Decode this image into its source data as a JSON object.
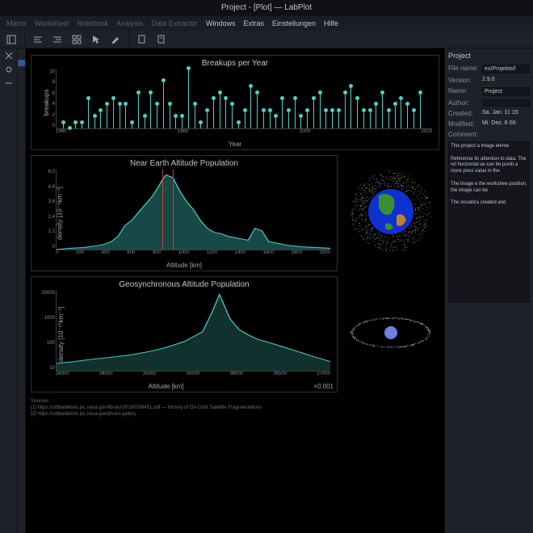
{
  "window": {
    "title": "Project - [Plot] — LabPlot"
  },
  "menu": {
    "items": [
      "Matrix",
      "Worksheet",
      "Notebook",
      "Analysis",
      "Data Extractor",
      "Windows",
      "Extras",
      "Einstellungen",
      "Hilfe"
    ],
    "active_from": 5
  },
  "charts": {
    "breakups": {
      "title": "Breakups per Year",
      "ylabel": "breakups",
      "xlabel": "Year"
    },
    "near_earth": {
      "title": "Near Earth Altitude Population",
      "ylabel": "density [10⁻⁸km⁻³]",
      "xlabel": "Altitude [km]"
    },
    "geo": {
      "title": "Geosynchronous Altitude Population",
      "ylabel": "density [10⁻¹⁰km⁻³]",
      "xlabel": "Altitude [km]",
      "xcap": "×0.001"
    }
  },
  "sources": {
    "head": "Sources:",
    "s1": "[1] https://orbitaldebris.jsc.nasa.gov/library/20180008451.pdf — History of On-Orbit Satellite Fragmentations",
    "s2": "[2] https://orbitaldebris.jsc.nasa.gov/photo-gallery"
  },
  "props": {
    "title": "Project",
    "labels": {
      "filename": "File name:",
      "version": "Version:",
      "name": "Name:",
      "author": "Author:",
      "created": "Created:",
      "modified": "Modified:",
      "comment": "Comment:"
    },
    "filename": "ex/Projekte/l",
    "version": "2.9.0",
    "name": "Project",
    "author": "",
    "created": "Sa. Jan. 11 15",
    "modified": "Mi. Dez. 8 08:",
    "comment_p1": "This project a image eleme",
    "comment_p2": "Reference lin attention to data. The ref horizontal ax can be positi a more preci value in the",
    "comment_p3": "The image e the workshee position, the image can be",
    "comment_p4": "The visualiza created and"
  },
  "chart_data": [
    {
      "type": "lollipop",
      "title": "Breakups per Year",
      "xlabel": "Year",
      "ylabel": "breakups",
      "xlim": [
        1960,
        2020
      ],
      "ylim": [
        0,
        10
      ],
      "x": [
        1961,
        1962,
        1963,
        1964,
        1965,
        1966,
        1967,
        1968,
        1969,
        1970,
        1971,
        1972,
        1973,
        1974,
        1975,
        1976,
        1977,
        1978,
        1979,
        1980,
        1981,
        1982,
        1983,
        1984,
        1985,
        1986,
        1987,
        1988,
        1989,
        1990,
        1991,
        1992,
        1993,
        1994,
        1995,
        1996,
        1997,
        1998,
        1999,
        2000,
        2001,
        2002,
        2003,
        2004,
        2005,
        2006,
        2007,
        2008,
        2009,
        2010,
        2011,
        2012,
        2013,
        2014,
        2015,
        2016,
        2017,
        2018
      ],
      "y": [
        1,
        0,
        1,
        1,
        5,
        2,
        3,
        4,
        5,
        4,
        4,
        1,
        6,
        2,
        6,
        4,
        8,
        4,
        2,
        2,
        10,
        4,
        1,
        3,
        5,
        6,
        5,
        4,
        1,
        3,
        7,
        6,
        3,
        3,
        2,
        5,
        3,
        5,
        2,
        3,
        5,
        6,
        3,
        3,
        3,
        6,
        7,
        5,
        3,
        3,
        4,
        6,
        3,
        4,
        5,
        4,
        3,
        6
      ]
    },
    {
      "type": "area",
      "title": "Near Earth Altitude Population",
      "xlabel": "Altitude [km]",
      "ylabel": "density [1e-8 km^-3]",
      "xlim": [
        0,
        2000
      ],
      "ylim": [
        0,
        6
      ],
      "reference_lines_x": [
        770,
        850
      ],
      "x": [
        0,
        100,
        200,
        300,
        350,
        400,
        450,
        500,
        550,
        600,
        650,
        700,
        750,
        770,
        800,
        850,
        900,
        950,
        1000,
        1050,
        1100,
        1150,
        1200,
        1250,
        1300,
        1350,
        1400,
        1450,
        1500,
        1550,
        1600,
        1700,
        1800,
        1900,
        2000
      ],
      "y": [
        0,
        0.1,
        0.15,
        0.3,
        0.4,
        0.6,
        1.0,
        1.8,
        2.2,
        2.8,
        3.4,
        4.0,
        4.8,
        5.2,
        5.6,
        5.4,
        4.4,
        3.6,
        3.0,
        2.2,
        1.6,
        1.3,
        1.2,
        1.0,
        0.9,
        0.8,
        0.7,
        1.6,
        1.4,
        0.6,
        0.5,
        0.3,
        0.2,
        0.15,
        0.1
      ]
    },
    {
      "type": "line",
      "title": "Geosynchronous Altitude Population",
      "xlabel": "Altitude [km]",
      "ylabel": "density [1e-10 km^-3]",
      "xlim": [
        34000,
        37000
      ],
      "ylim": [
        5,
        10000
      ],
      "yscale": "log",
      "x": [
        34000,
        34200,
        34400,
        34600,
        34800,
        35000,
        35200,
        35400,
        35600,
        35700,
        35786,
        35900,
        36000,
        36100,
        36200,
        36400,
        36600,
        36800,
        37000
      ],
      "y": [
        10,
        12,
        15,
        18,
        22,
        30,
        45,
        80,
        200,
        1200,
        7000,
        700,
        250,
        150,
        100,
        60,
        35,
        20,
        12
      ]
    }
  ]
}
